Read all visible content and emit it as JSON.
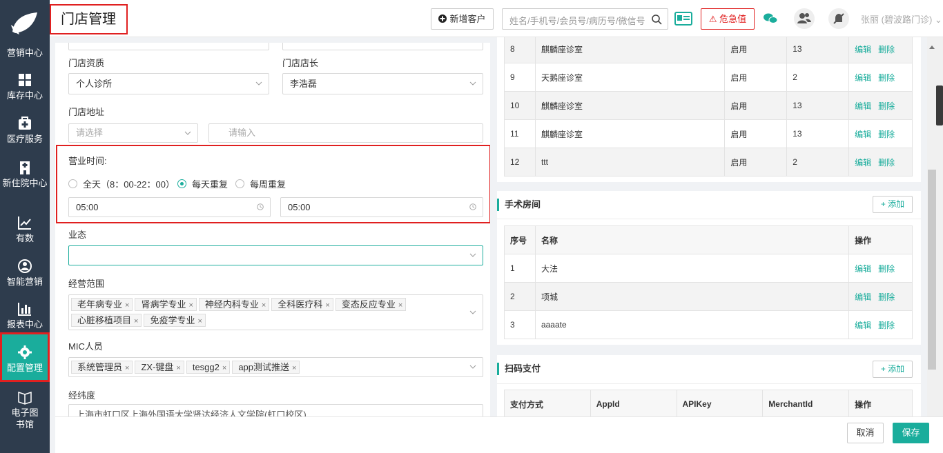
{
  "sidebar": {
    "items": [
      {
        "label": "营销中心",
        "icon": "leaf-logo-icon"
      },
      {
        "label": "库存中心",
        "icon": "grid-icon"
      },
      {
        "label": "医疗服务",
        "icon": "medical-kit-icon"
      },
      {
        "label": "新住院中心",
        "icon": "hospital-building-icon"
      },
      {
        "label": "有数",
        "icon": "trend-chart-icon"
      },
      {
        "label": "智能营销",
        "icon": "smart-marketing-icon"
      },
      {
        "label": "报表中心",
        "icon": "bar-chart-icon"
      },
      {
        "label": "配置管理",
        "icon": "gear-icon"
      },
      {
        "label": "电子图书馆",
        "icon": "book-icon"
      }
    ],
    "active_index": 7
  },
  "header": {
    "title": "门店管理",
    "new_customer": "新增客户",
    "search_placeholder": "姓名/手机号/会员号/病历号/微信号",
    "danger_label": "危急值",
    "user": "张丽 (碧波路门诊)"
  },
  "form": {
    "qualification_label": "门店资质",
    "qualification_value": "个人诊所",
    "manager_label": "门店店长",
    "manager_value": "李浩磊",
    "address_label": "门店地址",
    "address_select_placeholder": "请选择",
    "address_input_placeholder": "请输入",
    "hours_label": "营业时间:",
    "hours_options": [
      "全天（8：00-22：00）",
      "每天重复",
      "每周重复"
    ],
    "hours_selected": 1,
    "time_start": "05:00",
    "time_end": "05:00",
    "business_label": "业态",
    "scope_label": "经营范围",
    "scope_tags": [
      "老年病专业",
      "肾病学专业",
      "神经内科专业",
      "全科医疗科",
      "变态反应专业",
      "心脏移植项目",
      "免疫学专业"
    ],
    "mic_label": "MIC人员",
    "mic_tags": [
      "系统管理员",
      "ZX-键盘",
      "tesgg2",
      "app测试推送"
    ],
    "latlng_label": "经纬度",
    "latlng_value": "上海市虹口区上海外国语大学贤达经济人文学院(虹口校区)"
  },
  "rooms_table": {
    "rows": [
      {
        "no": "8",
        "name": "麒麟座诊室",
        "status": "启用",
        "count": "13"
      },
      {
        "no": "9",
        "name": "天鹅座诊室",
        "status": "启用",
        "count": "2"
      },
      {
        "no": "10",
        "name": "麒麟座诊室",
        "status": "启用",
        "count": "13"
      },
      {
        "no": "11",
        "name": "麒麟座诊室",
        "status": "启用",
        "count": "13"
      },
      {
        "no": "12",
        "name": "ttt",
        "status": "启用",
        "count": "2"
      }
    ],
    "edit": "编辑",
    "delete": "删除"
  },
  "surgery": {
    "title": "手术房间",
    "add": "+ 添加",
    "headers": [
      "序号",
      "名称",
      "操作"
    ],
    "rows": [
      {
        "no": "1",
        "name": "大法"
      },
      {
        "no": "2",
        "name": "项城"
      },
      {
        "no": "3",
        "name": "aaaate"
      }
    ]
  },
  "payment": {
    "title": "扫码支付",
    "add": "+ 添加",
    "headers": [
      "支付方式",
      "AppId",
      "APIKey",
      "MerchantId",
      "操作"
    ]
  },
  "footer": {
    "cancel": "取消",
    "save": "保存"
  },
  "colors": {
    "sidebar": "#2e3c4d",
    "accent": "#1aad9c",
    "highlight": "#e02020"
  }
}
